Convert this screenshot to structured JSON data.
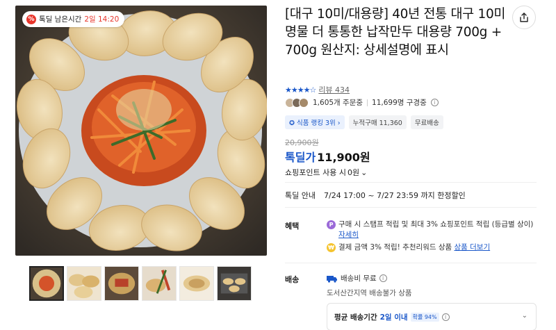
{
  "gallery": {
    "timer_label": "톡딜 남은시간",
    "timer_value": "2일 14:20",
    "thumb_count": 6
  },
  "product": {
    "title": "[대구 10미/대용량] 40년 전통 대구 10미 명물 더 통통한 납작만두 대용량 700g + 700g 원산지: 상세설명에 표시",
    "stars": "★★★★☆",
    "review_link": "리뷰 434",
    "orders": "1,605개 주문중",
    "viewers": "11,699명 구경중",
    "tags": [
      "식품 랭킹 3위",
      "누적구매 11,360",
      "무료배송"
    ],
    "original_price": "20,900원",
    "price_label": "톡딜가",
    "price": "11,900원",
    "point_text": "쇼핑포인트 사용 시",
    "point_value": "0원"
  },
  "deal": {
    "label": "톡딜 안내",
    "value": "7/24 17:00 ~ 7/27 23:59 까지 한정할인"
  },
  "benefits": {
    "label": "혜택",
    "item1_text": "구매 시 스탬프 적립 및 최대 3% 쇼핑포인트 적립 (등급별 상이)",
    "item1_link": "자세히",
    "item2_text": "결제 금액 3% 적립! 추천리워드 상품",
    "item2_link": "상품 더보기"
  },
  "shipping": {
    "label": "배송",
    "fee": "배송비 무료",
    "note": "도서산간지역 배송불가 상품",
    "avg_label": "평균 배송기간",
    "avg_value": "2일 이내",
    "avg_badge": "확률 94%"
  },
  "colors": {
    "accent": "#1a57c9",
    "timer": "#e8352b"
  }
}
